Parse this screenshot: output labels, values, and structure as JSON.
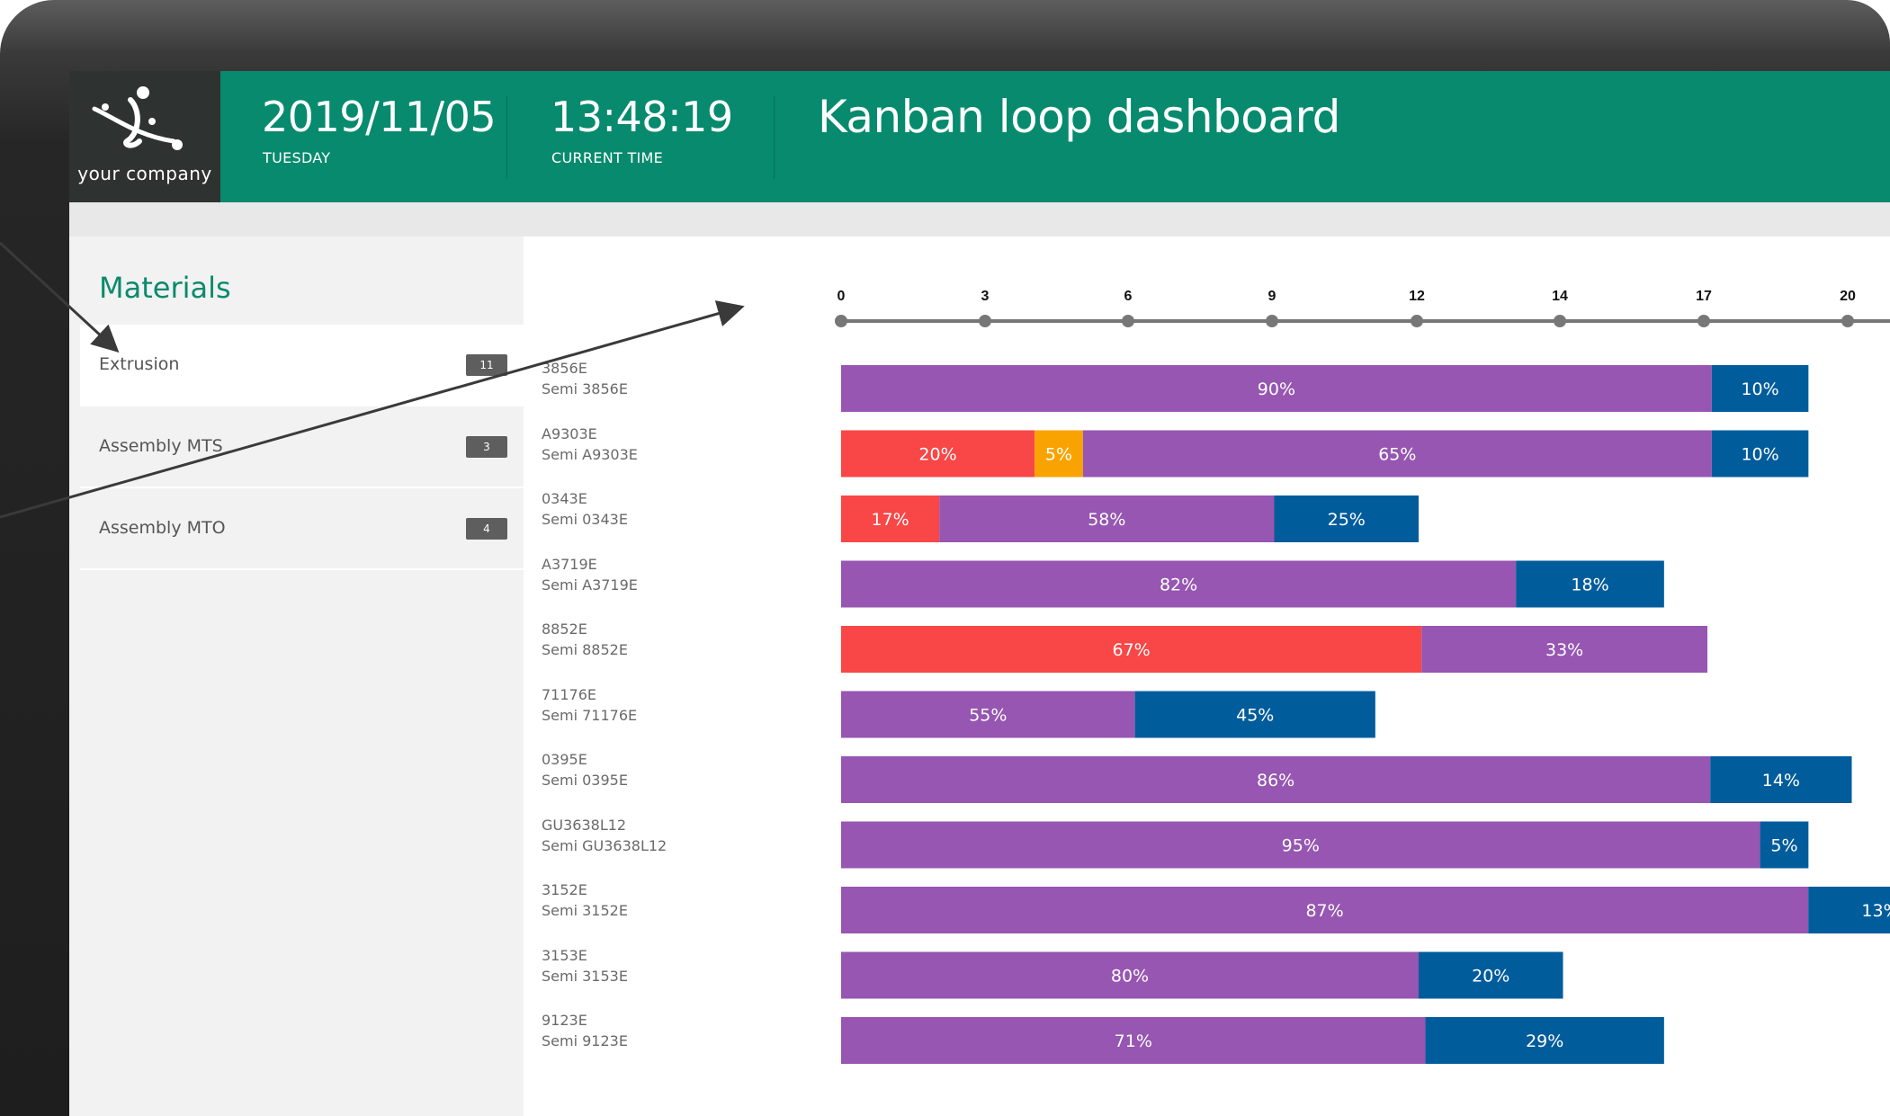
{
  "header": {
    "logo_text": "your company",
    "date": "2019/11/05",
    "weekday": "TUESDAY",
    "time": "13:48:19",
    "time_caption": "CURRENT TIME",
    "title": "Kanban loop dashboard",
    "accent_color": "#078a6d"
  },
  "sidebar": {
    "title": "Materials",
    "items": [
      {
        "label": "Extrusion",
        "count": "11",
        "active": true
      },
      {
        "label": "Assembly MTS",
        "count": "3",
        "active": false
      },
      {
        "label": "Assembly MTO",
        "count": "4",
        "active": false
      }
    ]
  },
  "colors": {
    "red": "#f94646",
    "orange": "#f9a302",
    "purple": "#9656b1",
    "blue": "#015c9c"
  },
  "chart_data": {
    "type": "bar",
    "orientation": "horizontal",
    "stacked": true,
    "axis_ticks": [
      "0",
      "3",
      "6",
      "9",
      "12",
      "14",
      "17",
      "20"
    ],
    "axis_tick_values": [
      0,
      3,
      6,
      9,
      12,
      14,
      17,
      20
    ],
    "rows": [
      {
        "id": "3856E",
        "sub": "Semi 3856E",
        "total": 20.1,
        "segments": [
          {
            "color": "purple",
            "pct": 90,
            "label": "90%"
          },
          {
            "color": "blue",
            "pct": 10,
            "label": "10%"
          }
        ]
      },
      {
        "id": "A9303E",
        "sub": "Semi A9303E",
        "total": 20.1,
        "segments": [
          {
            "color": "red",
            "pct": 20,
            "label": "20%"
          },
          {
            "color": "orange",
            "pct": 5,
            "label": "5%"
          },
          {
            "color": "purple",
            "pct": 65,
            "label": "65%"
          },
          {
            "color": "blue",
            "pct": 10,
            "label": "10%"
          }
        ]
      },
      {
        "id": "0343E",
        "sub": "Semi 0343E",
        "total": 12.0,
        "segments": [
          {
            "color": "red",
            "pct": 17,
            "label": "17%"
          },
          {
            "color": "purple",
            "pct": 58,
            "label": "58%"
          },
          {
            "color": "blue",
            "pct": 25,
            "label": "25%"
          }
        ]
      },
      {
        "id": "A3719E",
        "sub": "Semi A3719E",
        "total": 17.1,
        "segments": [
          {
            "color": "purple",
            "pct": 82,
            "label": "82%"
          },
          {
            "color": "blue",
            "pct": 18,
            "label": "18%"
          }
        ]
      },
      {
        "id": "8852E",
        "sub": "Semi 8852E",
        "total": 18.0,
        "segments": [
          {
            "color": "red",
            "pct": 67,
            "label": "67%"
          },
          {
            "color": "purple",
            "pct": 33,
            "label": "33%"
          }
        ]
      },
      {
        "id": "71176E",
        "sub": "Semi 71176E",
        "total": 11.1,
        "segments": [
          {
            "color": "purple",
            "pct": 55,
            "label": "55%"
          },
          {
            "color": "blue",
            "pct": 45,
            "label": "45%"
          }
        ]
      },
      {
        "id": "0395E",
        "sub": "Semi 0395E",
        "total": 21.0,
        "segments": [
          {
            "color": "purple",
            "pct": 86,
            "label": "86%"
          },
          {
            "color": "blue",
            "pct": 14,
            "label": "14%"
          }
        ]
      },
      {
        "id": "GU3638L12",
        "sub": "Semi GU3638L12",
        "total": 20.1,
        "segments": [
          {
            "color": "purple",
            "pct": 95,
            "label": "95%"
          },
          {
            "color": "blue",
            "pct": 5,
            "label": "5%"
          }
        ]
      },
      {
        "id": "3152E",
        "sub": "Semi 3152E",
        "total": 23.1,
        "segments": [
          {
            "color": "purple",
            "pct": 87,
            "label": "87%"
          },
          {
            "color": "blue",
            "pct": 13,
            "label": "13%"
          }
        ]
      },
      {
        "id": "3153E",
        "sub": "Semi 3153E",
        "total": 15.0,
        "segments": [
          {
            "color": "purple",
            "pct": 80,
            "label": "80%"
          },
          {
            "color": "blue",
            "pct": 20,
            "label": "20%"
          }
        ]
      },
      {
        "id": "9123E",
        "sub": "Semi 9123E",
        "total": 17.1,
        "segments": [
          {
            "color": "purple",
            "pct": 71,
            "label": "71%"
          },
          {
            "color": "blue",
            "pct": 29,
            "label": "29%"
          }
        ]
      }
    ]
  }
}
